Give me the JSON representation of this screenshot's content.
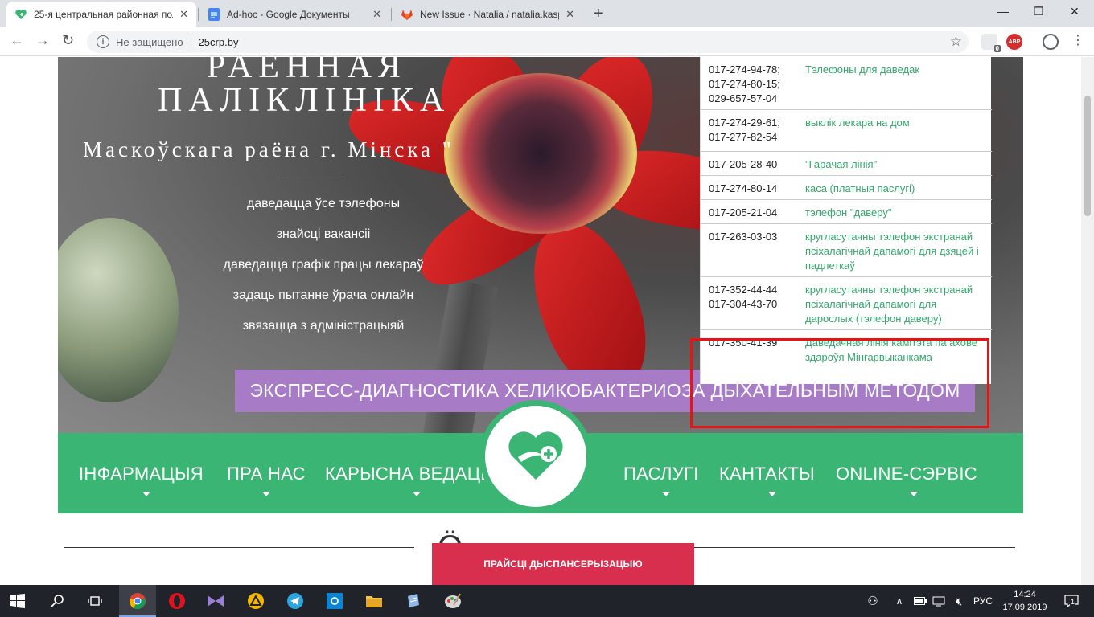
{
  "browser": {
    "tabs": [
      {
        "title": "25-я центральная районная пол",
        "active": true,
        "icon": "heart-plus-icon"
      },
      {
        "title": "Ad-hoc - Google Документы",
        "active": false,
        "icon": "docs-icon"
      },
      {
        "title": "New Issue · Natalia / natalia.kasp",
        "active": false,
        "icon": "gitlab-icon"
      }
    ],
    "new_tab_label": "+",
    "security_label": "Не защищено",
    "url": "25crp.by",
    "ext_badge_count": "0",
    "abp_label": "ABP"
  },
  "hero": {
    "title_line1": "РАЁННАЯ",
    "title_line2": "ПАЛІКЛІНІКА",
    "subtitle": "Маскоўскага раёна г. Мінска \"",
    "links": [
      "даведацца ўсе тэлефоны",
      "знайсці вакансіі",
      "даведацца графік працы лекараў",
      "задаць пытанне ўрача онлайн",
      "звязацца з адміністрацыяй"
    ],
    "banner": "ЭКСПРЕСС-ДИАГНОСТИКА ХЕЛИКОБАКТЕРИОЗА ДЫХАТЕЛЬНЫМ МЕТОДОМ"
  },
  "phones": [
    {
      "numbers": "017-274-94-78;\n017-274-80-15;\n029-657-57-04",
      "desc": "Тэлефоны для даведак"
    },
    {
      "numbers": "017-274-29-61;\n017-277-82-54",
      "desc": "выклік лекара на дом"
    },
    {
      "numbers": "017-205-28-40",
      "desc": "\"Гарачая лінія\""
    },
    {
      "numbers": "017-274-80-14",
      "desc": "каса (платныя паслугі)"
    },
    {
      "numbers": "017-205-21-04",
      "desc": "тэлефон \"даверу\""
    },
    {
      "numbers": "017-263-03-03",
      "desc": "кругласутачны тэлефон экстранай псіхалагічнай дапамогі для дзяцей і падлеткаў"
    },
    {
      "numbers": "017-352-44-44\n017-304-43-70",
      "desc": "кругласутачны тэлефон экстранай псіхалагічнай дапамогі для дарослых (тэлефон даверу)"
    },
    {
      "numbers": "017-350-41-39",
      "desc": "Даведачная лінія камітэта па ахове здароўя Мінгарвыканкама"
    }
  ],
  "menu": {
    "left": [
      "ІНФАРМАЦЫЯ",
      "ПРА НАС",
      "КАРЫСНА ВЕДАЦЬ"
    ],
    "right": [
      "ПАСЛУГІ",
      "КАНТАКТЫ",
      "ONLINE-СЭРВІС"
    ]
  },
  "heading_fragment": "Ö",
  "cta": "ПРАЙСЦІ ДЫСПАНСЕРЫЗАЦЫЮ",
  "taskbar": {
    "lang": "РУС",
    "time": "14:24",
    "date": "17.09.2019",
    "notif_count": "1"
  },
  "colors": {
    "brand_green": "#3bb574",
    "banner_purple": "#a87bc7",
    "cta_red": "#d72f4d",
    "highlight_red": "#ee1111",
    "link_green": "#34a86b"
  }
}
